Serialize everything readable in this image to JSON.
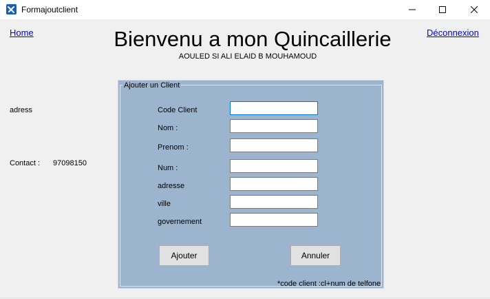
{
  "window": {
    "title": "Formajoutclient"
  },
  "nav": {
    "home": "Home",
    "logout": "Déconnexion"
  },
  "header": {
    "title": "Bienvenu a mon Quincaillerie",
    "subtitle": "AOULED SI ALI ELAID B MOUHAMOUD"
  },
  "sidebar": {
    "address_label": "adress",
    "contact_label": "Contact :",
    "contact_value": "97098150"
  },
  "form": {
    "legend": "Ajouter un Client",
    "fields": [
      {
        "label": "Code Client",
        "value": ""
      },
      {
        "label": "Nom :",
        "value": ""
      },
      {
        "label": "Prenom :",
        "value": ""
      },
      {
        "label": "Num :",
        "value": ""
      },
      {
        "label": "adresse",
        "value": ""
      },
      {
        "label": "ville",
        "value": ""
      },
      {
        "label": "governement",
        "value": ""
      }
    ],
    "add_button": "Ajouter",
    "cancel_button": "Annuler",
    "note": "*code client :cl+num de telfone"
  },
  "colors": {
    "group_background": "#9db4cf",
    "link": "#0000ee",
    "focus_border": "#0078d7"
  }
}
